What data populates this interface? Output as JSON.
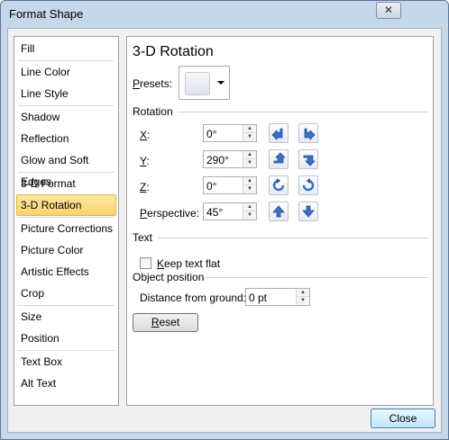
{
  "window": {
    "title": "Format Shape",
    "close_glyph": "✕"
  },
  "nav": {
    "items": [
      {
        "label": "Fill"
      },
      {
        "label": "Line Color"
      },
      {
        "label": "Line Style"
      },
      {
        "label": "Shadow"
      },
      {
        "label": "Reflection"
      },
      {
        "label": "Glow and Soft Edges"
      },
      {
        "label": "3-D Format"
      },
      {
        "label": "3-D Rotation"
      },
      {
        "label": "Picture Corrections"
      },
      {
        "label": "Picture Color"
      },
      {
        "label": "Artistic Effects"
      },
      {
        "label": "Crop"
      },
      {
        "label": "Size"
      },
      {
        "label": "Position"
      },
      {
        "label": "Text Box"
      },
      {
        "label": "Alt Text"
      }
    ],
    "selected": "3-D Rotation"
  },
  "panel": {
    "title": "3-D Rotation",
    "presets": {
      "label_accel": "P",
      "label_rest": "resets:"
    },
    "rotation": {
      "header": "Rotation",
      "x": {
        "accel": "X",
        "rest": ":",
        "value": "0°"
      },
      "y": {
        "accel": "Y",
        "rest": ":",
        "value": "290°"
      },
      "z": {
        "accel": "Z",
        "rest": ":",
        "value": "0°"
      },
      "perspective": {
        "accel": "P",
        "rest": "erspective:",
        "value": "45°"
      }
    },
    "text": {
      "header": "Text",
      "keep_flat": {
        "accel": "K",
        "rest": "eep text flat",
        "checked": false
      }
    },
    "object_position": {
      "header": "Object position",
      "distance": {
        "label": "Distance from ground:",
        "value": "0 pt"
      }
    },
    "reset": {
      "accel": "R",
      "rest": "eset"
    }
  },
  "footer": {
    "close_label": "Close"
  },
  "icons": {
    "spin_up": "▲",
    "spin_down": "▼"
  },
  "colors": {
    "selection": "#f8d36b",
    "arrow_blue": "#3b6fc2",
    "frame": "#c7d7ea"
  }
}
